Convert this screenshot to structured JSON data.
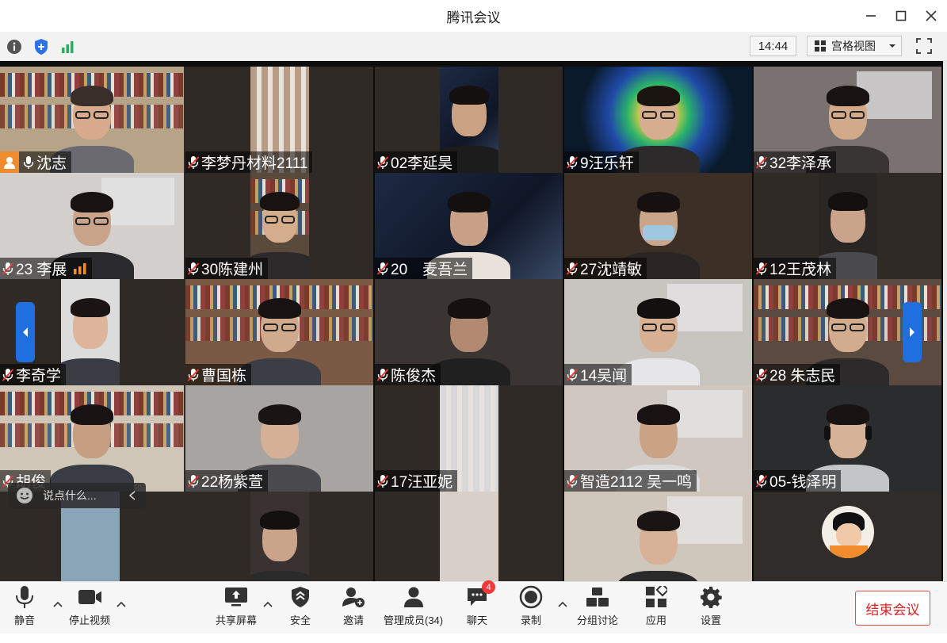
{
  "window": {
    "title": "腾讯会议",
    "icons": [
      "minimize-icon",
      "maximize-icon",
      "close-icon"
    ]
  },
  "toolbar": {
    "time": "14:44",
    "view_mode": "宫格视图",
    "icons": [
      "info-icon",
      "shield-icon",
      "signal-icon",
      "grid-icon",
      "chevron-down-icon",
      "fullscreen-icon"
    ]
  },
  "participants": [
    {
      "name": "沈志",
      "host": true,
      "muted": false
    },
    {
      "name": "李梦丹材料2111",
      "muted": true
    },
    {
      "name": "02李延昊",
      "muted": true
    },
    {
      "name": "9汪乐轩",
      "muted": true
    },
    {
      "name": "32李泽承",
      "muted": true
    },
    {
      "name": "23 李展",
      "muted": true,
      "speaking": true
    },
    {
      "name": "30陈建州",
      "muted": true
    },
    {
      "name": "20　麦吾兰",
      "muted": true
    },
    {
      "name": "27沈靖敏",
      "muted": true
    },
    {
      "name": "12王茂林",
      "muted": true
    },
    {
      "name": "李奇学",
      "muted": true
    },
    {
      "name": "曹国栋",
      "muted": true
    },
    {
      "name": "陈俊杰",
      "muted": true
    },
    {
      "name": "14吴闻",
      "muted": true
    },
    {
      "name": "28 朱志民",
      "muted": true
    },
    {
      "name": "胡俊",
      "muted": true
    },
    {
      "name": "22杨紫萱",
      "muted": true
    },
    {
      "name": "17汪亚妮",
      "muted": true
    },
    {
      "name": "智造2112 吴一鸣",
      "muted": true
    },
    {
      "name": "05-钱泽明",
      "muted": true
    }
  ],
  "chat": {
    "placeholder": "说点什么..."
  },
  "bottom": {
    "mute": "静音",
    "stop_video": "停止视频",
    "share_screen": "共享屏幕",
    "security": "安全",
    "invite": "邀请",
    "manage_members": "管理成员(34)",
    "chat": "聊天",
    "chat_unread": "4",
    "record": "录制",
    "breakout": "分组讨论",
    "apps": "应用",
    "settings": "设置",
    "end_meeting": "结束会议"
  },
  "colors": {
    "accent_blue": "#1f6fe0",
    "end_red": "#e02020",
    "host_orange": "#f08c2c",
    "speaking_orange": "#ff8c1a",
    "muted_red": "#e53935"
  }
}
